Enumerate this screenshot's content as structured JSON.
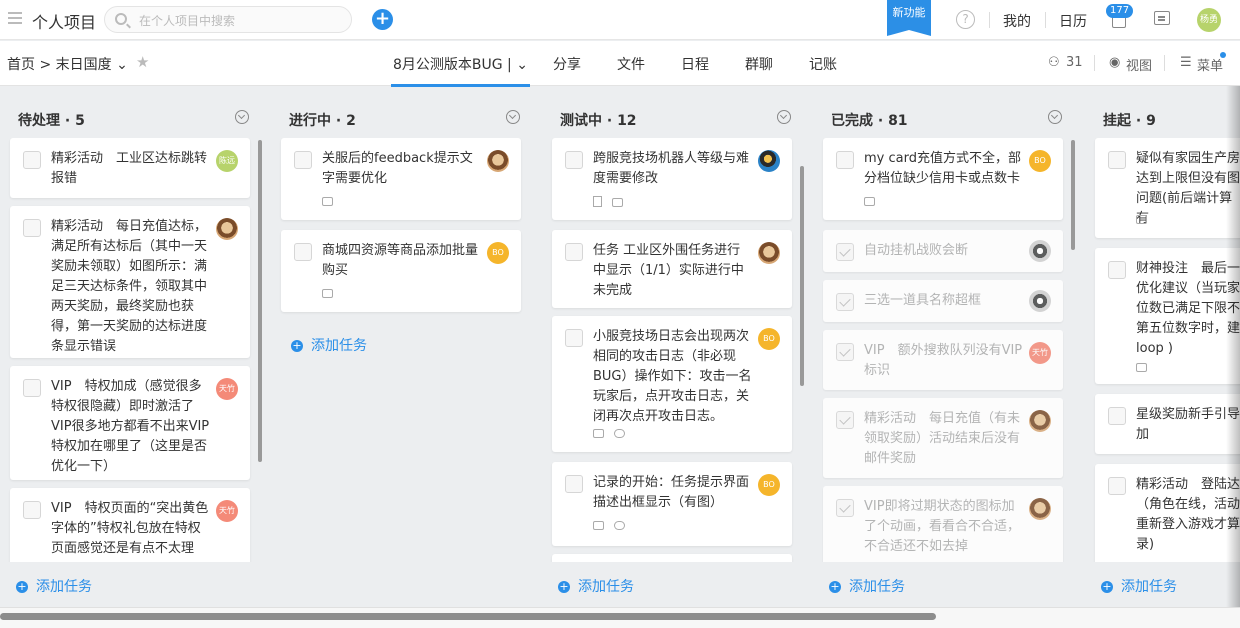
{
  "topbar": {
    "title": "个人项目",
    "search_placeholder": "在个人项目中搜索",
    "add_label": "+",
    "new_feature": "新功能",
    "help_label": "?",
    "mine": "我的",
    "calendar": "日历",
    "notification_count": "177",
    "user_initials": "杨勇"
  },
  "subbar": {
    "breadcrumb": "首页 > 末日国度 ⌄",
    "tabs": [
      "8月公测版本BUG  |  ⌄",
      "分享",
      "文件",
      "日程",
      "群聊",
      "记账"
    ],
    "members": "31",
    "view": "视图",
    "menu": "菜单"
  },
  "columns": [
    {
      "title": "待处理 · 5",
      "add": "添加任务",
      "cards": [
        {
          "text": "精彩活动　工业区达标跳转报错",
          "avatar": "陈远",
          "avatar_style": "green",
          "done": false,
          "meta": []
        },
        {
          "text": "精彩活动　每日充值达标，满足所有达标后（其中一天奖励未领取）如图所示：满足三天达标条件，领取其中两天奖励，最终奖励也获得，第一天奖励的达标进度条显示错误",
          "avatar": "",
          "avatar_style": "photo",
          "done": false,
          "meta": []
        },
        {
          "text": "VIP　特权加成（感觉很多特权很隐藏）即时激活了VIP很多地方都看不出来VIP 特权加在哪里了（这里是否优化一下）",
          "avatar": "天竹",
          "avatar_style": "pink",
          "done": false,
          "meta": []
        },
        {
          "text": "VIP　特权页面的“突出黄色字体的”特权礼包放在特权页面感觉还是有点不太理",
          "avatar": "天竹",
          "avatar_style": "pink",
          "done": false,
          "meta": []
        }
      ]
    },
    {
      "title": "进行中 · 2",
      "add": "添加任务",
      "cards": [
        {
          "text": "关服后的feedback提示文字需要优化",
          "avatar": "",
          "avatar_style": "photo",
          "done": false,
          "meta": [
            "comment"
          ]
        },
        {
          "text": "商城四资源等商品添加批量购买",
          "avatar": "BO",
          "avatar_style": "orange",
          "done": false,
          "meta": [
            "comment"
          ]
        }
      ]
    },
    {
      "title": "测试中 · 12",
      "add": "添加任务",
      "cards": [
        {
          "text": "跨服竞技场机器人等级与难度需要修改",
          "avatar": "",
          "avatar_style": "blue",
          "done": false,
          "meta": [
            "doc",
            "comment"
          ]
        },
        {
          "text": "任务 工业区外围任务进行中显示（1/1）实际进行中未完成",
          "avatar": "",
          "avatar_style": "photo",
          "done": false,
          "meta": []
        },
        {
          "text": "小服竞技场日志会出现两次相同的攻击日志（非必现BUG）操作如下：攻击一名玩家后，点开攻击日志，关闭再次点开攻击日志。",
          "avatar": "BO",
          "avatar_style": "orange",
          "done": false,
          "meta": [
            "comment",
            "link"
          ]
        },
        {
          "text": "记录的开始：任务提示界面描述出框显示（有图）",
          "avatar": "BO",
          "avatar_style": "orange",
          "done": false,
          "meta": [
            "comment",
            "link"
          ]
        }
      ]
    },
    {
      "title": "已完成 · 81",
      "add": "添加任务",
      "cards": [
        {
          "text": "my card充值方式不全，部分档位缺少信用卡或点数卡",
          "avatar": "BO",
          "avatar_style": "orange",
          "done": false,
          "meta": [
            "comment"
          ]
        },
        {
          "text": "自动挂机战败会断",
          "avatar": "",
          "avatar_style": "gray",
          "done": true,
          "meta": []
        },
        {
          "text": "三选一道具名称超框",
          "avatar": "",
          "avatar_style": "gray",
          "done": true,
          "meta": []
        },
        {
          "text": "VIP　额外搜救队列没有VIP标识",
          "avatar": "天竹",
          "avatar_style": "pink",
          "done": true,
          "meta": []
        },
        {
          "text": "精彩活动　每日充值（有未领取奖励）活动结束后没有邮件奖励",
          "avatar": "",
          "avatar_style": "photo",
          "done": true,
          "meta": []
        },
        {
          "text": "VIP即将过期状态的图标加了个动画，看看合不合适，不合适还不如去掉",
          "avatar": "",
          "avatar_style": "photo",
          "done": true,
          "meta": []
        }
      ]
    },
    {
      "title": "挂起 · 9",
      "add": "添加任务",
      "cards": [
        {
          "text": "疑似有家园生产房达到上限但没有图问题(前后端计算有",
          "avatar": "",
          "avatar_style": "",
          "done": false,
          "meta": [
            "comment"
          ]
        },
        {
          "text": "财神投注　最后一优化建议（当玩家位数已满足下限不第五位数字时，建loop )",
          "avatar": "",
          "avatar_style": "",
          "done": false,
          "meta": [
            "comment"
          ]
        },
        {
          "text": "星级奖励新手引导加",
          "avatar": "",
          "avatar_style": "",
          "done": false,
          "meta": []
        },
        {
          "text": "精彩活动　登陆达（角色在线，活动重新登入游戏才算录)",
          "avatar": "",
          "avatar_style": "",
          "done": false,
          "meta": []
        }
      ]
    }
  ]
}
